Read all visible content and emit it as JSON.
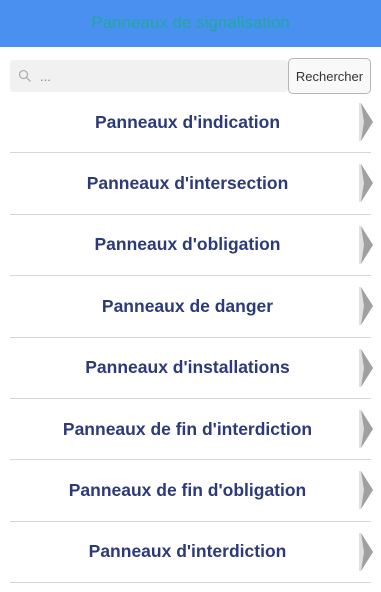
{
  "header": {
    "title": "Panneaux de signalisation",
    "title_color": "#1ea8a0",
    "background_color": "#4a90f0"
  },
  "search": {
    "placeholder": "...",
    "value": "",
    "icon": "search-icon",
    "button_label": "Rechercher"
  },
  "list": {
    "items": [
      {
        "label": "Panneaux d'indication",
        "icon": "chevron-right-icon"
      },
      {
        "label": "Panneaux d'intersection",
        "icon": "chevron-right-icon"
      },
      {
        "label": "Panneaux d'obligation",
        "icon": "chevron-right-icon"
      },
      {
        "label": "Panneaux de danger",
        "icon": "chevron-right-icon"
      },
      {
        "label": "Panneaux d'installations",
        "icon": "chevron-right-icon"
      },
      {
        "label": "Panneaux de fin d'interdiction",
        "icon": "chevron-right-icon"
      },
      {
        "label": "Panneaux de fin d'obligation",
        "icon": "chevron-right-icon"
      },
      {
        "label": "Panneaux d'interdiction",
        "icon": "chevron-right-icon"
      }
    ],
    "label_color": "#2c3a7a"
  }
}
